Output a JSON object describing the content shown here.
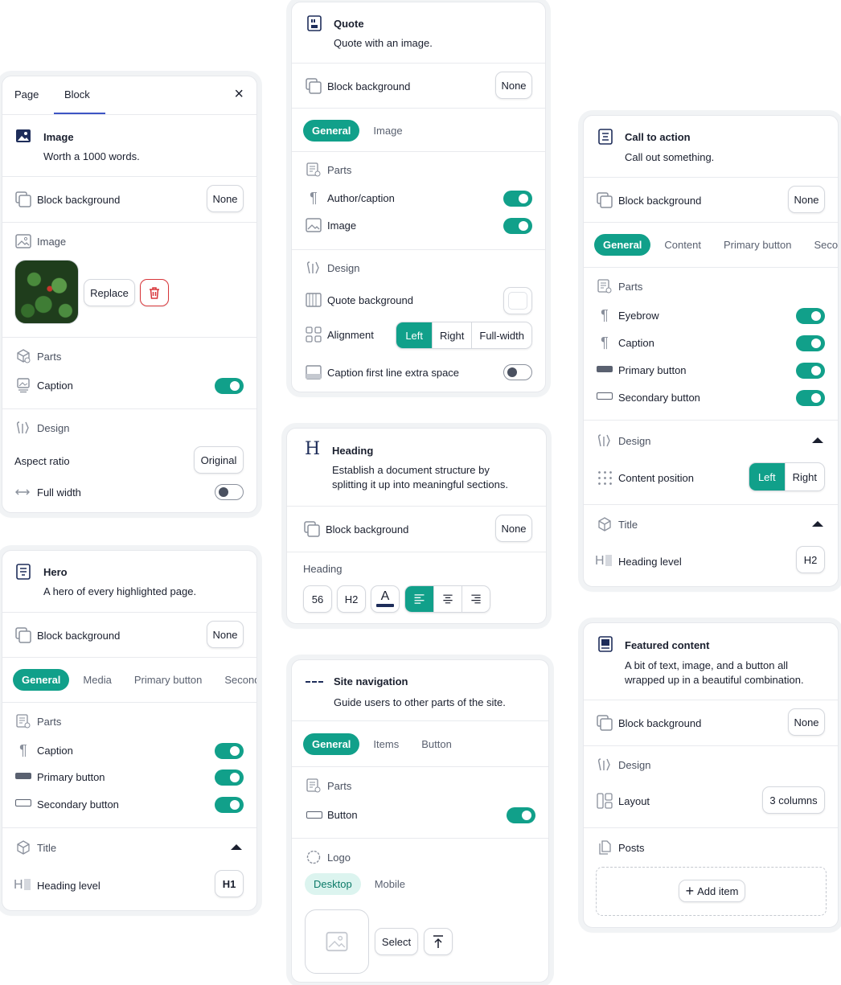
{
  "image_panel": {
    "tab_page": "Page",
    "tab_block": "Block",
    "close": "×",
    "title": "Image",
    "subtitle": "Worth a 1000 words.",
    "block_background": "Block background",
    "none": "None",
    "image_label": "Image",
    "replace": "Replace",
    "parts": "Parts",
    "caption": "Caption",
    "design": "Design",
    "aspect_ratio": "Aspect ratio",
    "original": "Original",
    "full_width": "Full width"
  },
  "hero_panel": {
    "title": "Hero",
    "subtitle": "A hero of every highlighted page.",
    "block_background": "Block background",
    "none": "None",
    "tabs": [
      "General",
      "Media",
      "Primary button",
      "Second"
    ],
    "parts": "Parts",
    "caption": "Caption",
    "primary_button": "Primary button",
    "secondary_button": "Secondary button",
    "title_section": "Title",
    "heading_level": "Heading level",
    "h1": "H1"
  },
  "quote_panel": {
    "title": "Quote",
    "subtitle": "Quote with an image.",
    "block_background": "Block background",
    "none": "None",
    "tabs": [
      "General",
      "Image"
    ],
    "parts": "Parts",
    "author_caption": "Author/caption",
    "image": "Image",
    "design": "Design",
    "quote_background": "Quote background",
    "alignment": "Alignment",
    "align_options": [
      "Left",
      "Right",
      "Full-width"
    ],
    "caption_space": "Caption first line extra space"
  },
  "heading_panel": {
    "title": "Heading",
    "subtitle_line1": "Establish a document structure by",
    "subtitle_line2": "splitting it up into meaningful sections.",
    "block_background": "Block background",
    "none": "None",
    "heading": "Heading",
    "size": "56",
    "level": "H2",
    "font_glyph": "A"
  },
  "sitenav_panel": {
    "title": "Site navigation",
    "subtitle": "Guide users to other parts of the site.",
    "tabs": [
      "General",
      "Items",
      "Button"
    ],
    "parts": "Parts",
    "button": "Button",
    "logo": "Logo",
    "logo_tabs": [
      "Desktop",
      "Mobile"
    ],
    "select": "Select"
  },
  "cta_panel": {
    "title": "Call to action",
    "subtitle": "Call out something.",
    "block_background": "Block background",
    "none": "None",
    "tabs": [
      "General",
      "Content",
      "Primary button",
      "Secor"
    ],
    "parts": "Parts",
    "eyebrow": "Eyebrow",
    "caption": "Caption",
    "primary_button": "Primary button",
    "secondary_button": "Secondary button",
    "design": "Design",
    "content_position": "Content position",
    "pos_options": [
      "Left",
      "Right"
    ],
    "title_section": "Title",
    "heading_level": "Heading level",
    "h2": "H2"
  },
  "featured_panel": {
    "title": "Featured content",
    "subtitle_line1": "A bit of text, image, and a button all",
    "subtitle_line2": "wrapped up in a beautiful combination.",
    "block_background": "Block background",
    "none": "None",
    "design": "Design",
    "layout": "Layout",
    "columns": "3 columns",
    "posts": "Posts",
    "add_item": "Add item"
  },
  "colors": {
    "accent": "#11a08a",
    "danger": "#d8363a",
    "navy": "#1e2d5a"
  }
}
